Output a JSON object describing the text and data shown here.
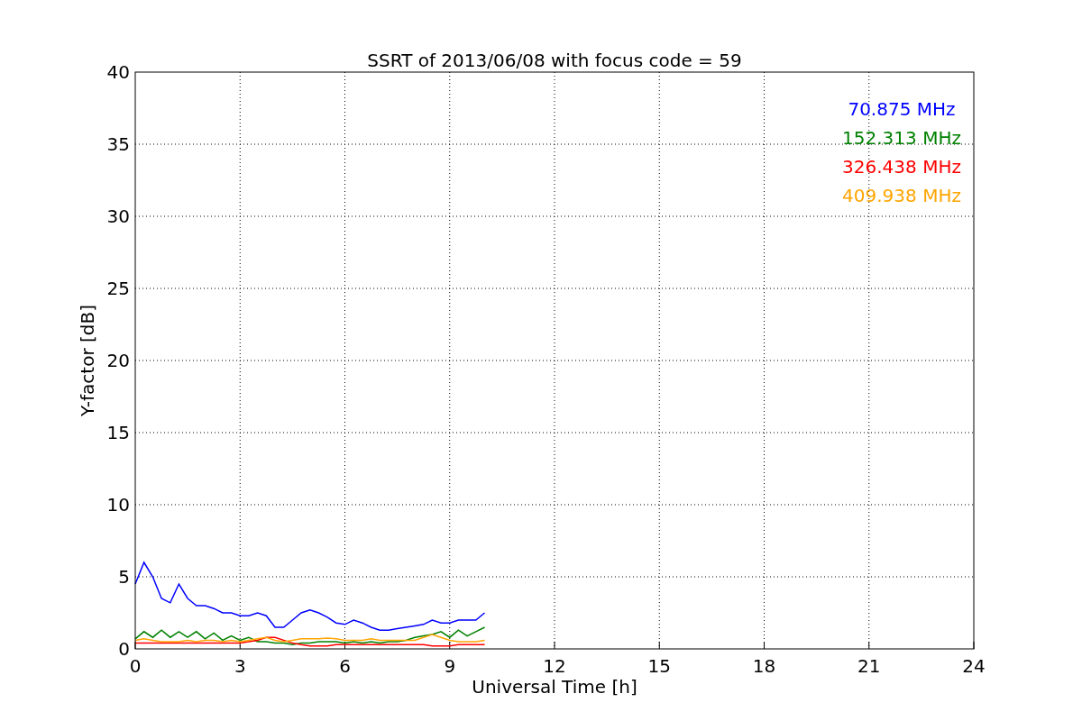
{
  "chart_data": {
    "type": "line",
    "title": "SSRT of 2013/06/08 with focus code = 59",
    "xlabel": "Universal Time [h]",
    "ylabel": "Y-factor [dB]",
    "x": [
      0,
      0.25,
      0.5,
      0.75,
      1,
      1.25,
      1.5,
      1.75,
      2,
      2.25,
      2.5,
      2.75,
      3,
      3.25,
      3.5,
      3.75,
      4,
      4.25,
      4.5,
      4.75,
      5,
      5.25,
      5.5,
      5.75,
      6,
      6.25,
      6.5,
      6.75,
      7,
      7.25,
      7.5,
      7.75,
      8,
      8.25,
      8.5,
      8.75,
      9,
      9.25,
      9.5,
      9.75,
      10
    ],
    "series": [
      {
        "name": "70.875 MHz",
        "color": "#0000ff",
        "values": [
          4.5,
          6,
          5,
          3.5,
          3.2,
          4.5,
          3.5,
          3,
          3,
          2.8,
          2.5,
          2.5,
          2.3,
          2.3,
          2.5,
          2.3,
          1.5,
          1.5,
          2,
          2.5,
          2.7,
          2.5,
          2.2,
          1.8,
          1.7,
          2,
          1.8,
          1.5,
          1.3,
          1.3,
          1.4,
          1.5,
          1.6,
          1.7,
          2,
          1.8,
          1.8,
          2,
          2,
          2,
          2.5
        ]
      },
      {
        "name": "152.313 MHz",
        "color": "#008000",
        "values": [
          0.7,
          1.2,
          0.8,
          1.3,
          0.8,
          1.2,
          0.8,
          1.2,
          0.7,
          1.1,
          0.6,
          0.9,
          0.6,
          0.8,
          0.5,
          0.5,
          0.4,
          0.4,
          0.3,
          0.4,
          0.4,
          0.5,
          0.5,
          0.5,
          0.4,
          0.5,
          0.4,
          0.5,
          0.4,
          0.5,
          0.5,
          0.6,
          0.8,
          0.9,
          1,
          1.2,
          0.8,
          1.3,
          0.9,
          1.2,
          1.5
        ]
      },
      {
        "name": "326.438 MHz",
        "color": "#ff0000",
        "values": [
          0.4,
          0.4,
          0.4,
          0.4,
          0.4,
          0.4,
          0.4,
          0.4,
          0.4,
          0.4,
          0.4,
          0.4,
          0.4,
          0.5,
          0.6,
          0.8,
          0.8,
          0.6,
          0.4,
          0.3,
          0.2,
          0.2,
          0.2,
          0.3,
          0.3,
          0.3,
          0.3,
          0.3,
          0.3,
          0.3,
          0.3,
          0.3,
          0.3,
          0.3,
          0.2,
          0.2,
          0.2,
          0.3,
          0.3,
          0.3,
          0.3
        ]
      },
      {
        "name": "409.938 MHz",
        "color": "#ffa500",
        "values": [
          0.6,
          0.7,
          0.6,
          0.5,
          0.5,
          0.5,
          0.6,
          0.5,
          0.6,
          0.6,
          0.5,
          0.6,
          0.5,
          0.6,
          0.7,
          0.8,
          0.6,
          0.5,
          0.6,
          0.7,
          0.7,
          0.7,
          0.75,
          0.7,
          0.6,
          0.6,
          0.6,
          0.7,
          0.6,
          0.6,
          0.6,
          0.6,
          0.6,
          0.8,
          1,
          0.8,
          0.6,
          0.5,
          0.5,
          0.5,
          0.6
        ]
      }
    ],
    "grid": true,
    "xlim": [
      0,
      24
    ],
    "ylim": [
      0,
      40
    ],
    "xticks": [
      0,
      3,
      6,
      9,
      12,
      15,
      18,
      21,
      24
    ],
    "yticks": [
      0,
      5,
      10,
      15,
      20,
      25,
      30,
      35,
      40
    ]
  }
}
